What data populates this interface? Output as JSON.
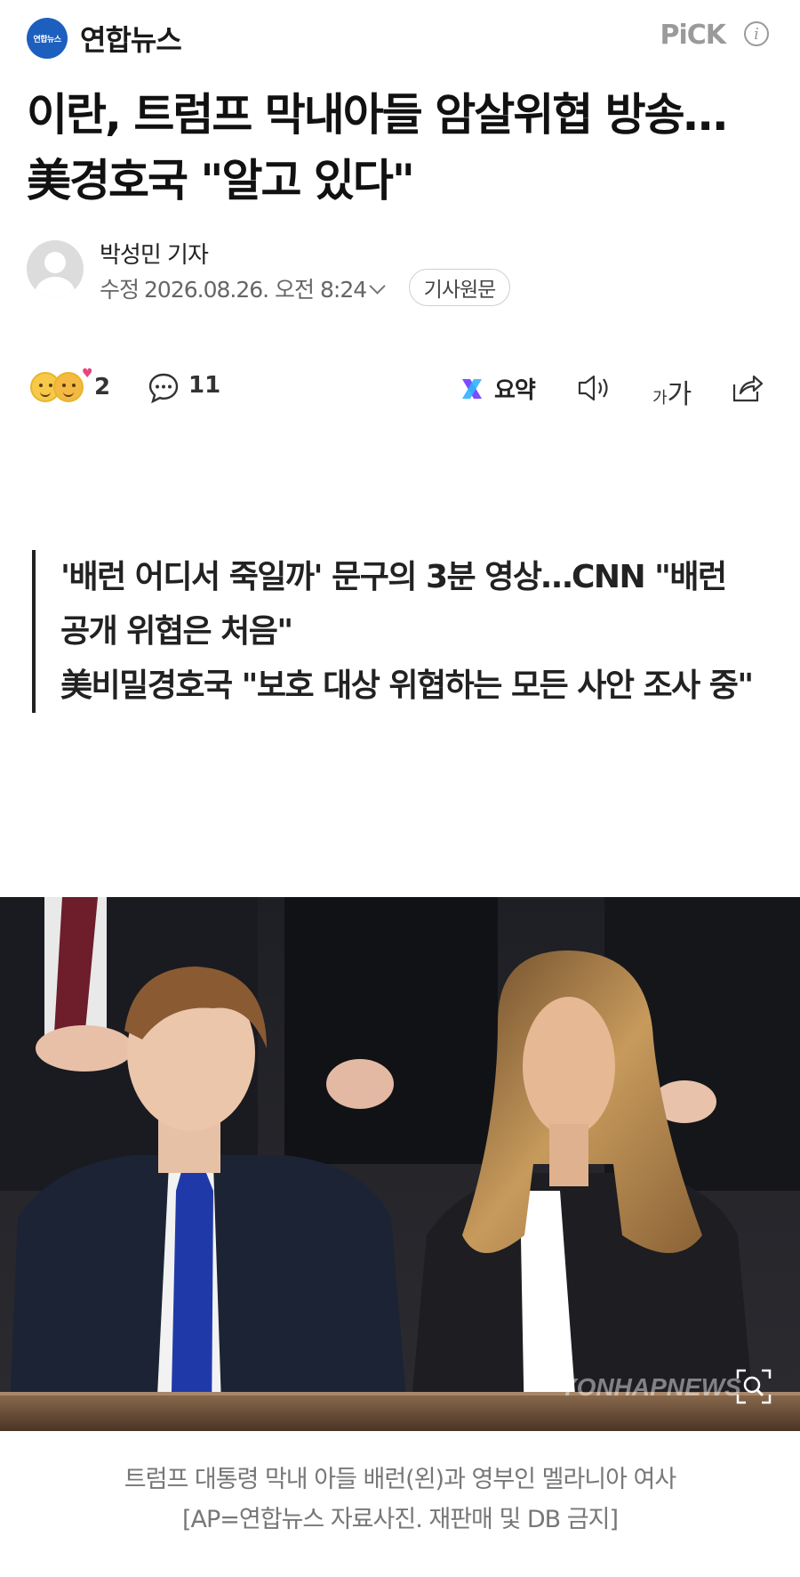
{
  "header": {
    "logo_text": "연합뉴스",
    "press_name": "연합뉴스",
    "pick_label": "PiCK",
    "info_icon": "info-icon"
  },
  "article": {
    "headline": "이란, 트럼프 막내아들 암살위협 방송…美경호국 \"알고 있다\"",
    "author": "박성민 기자",
    "modified_label": "수정",
    "date": "2026.08.26. 오전 8:24",
    "original_button": "기사원문"
  },
  "actions": {
    "reaction_count": "2",
    "comment_count": "11",
    "summary_label": "요약",
    "font_small": "가",
    "font_big": "가"
  },
  "subheadings": [
    "'배런 어디서 죽일까' 문구의 3분 영상…CNN \"배런 공개 위협은 처음\"",
    "美비밀경호국 \"보호 대상 위협하는 모든 사안 조사 중\""
  ],
  "photo": {
    "watermark": "YONHAPNEWS",
    "caption_line1": "트럼프 대통령 막내 아들 배런(왼)과 영부인 멜라니아 여사",
    "caption_line2": "[AP=연합뉴스 자료사진. 재판매 및 DB 금지]"
  },
  "colors": {
    "brand_blue": "#1d5fbf",
    "pick_gray": "#9a9a9a",
    "text_dark": "#111111",
    "caption_gray": "#777777"
  }
}
